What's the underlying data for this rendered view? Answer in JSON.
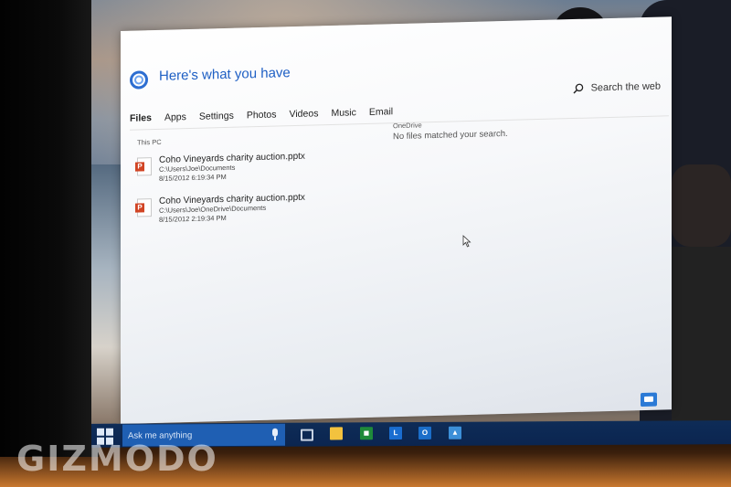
{
  "panel": {
    "title": "Here's what you have",
    "search_web_label": "Search the web",
    "tabs": [
      "Files",
      "Apps",
      "Settings",
      "Photos",
      "Videos",
      "Music",
      "Email"
    ],
    "active_tab": "Files"
  },
  "this_pc": {
    "label": "This PC",
    "files": [
      {
        "name": "Coho Vineyards charity auction.pptx",
        "path": "C:\\Users\\Joe\\Documents",
        "date": "8/15/2012 6:19:34 PM"
      },
      {
        "name": "Coho Vineyards charity auction.pptx",
        "path": "C:\\Users\\Joe\\OneDrive\\Documents",
        "date": "8/15/2012 2:19:34 PM"
      }
    ]
  },
  "onedrive": {
    "label": "OneDrive",
    "message": "No files matched your search."
  },
  "taskbar": {
    "search_placeholder": "Ask me anything",
    "apps": [
      "task-view",
      "file-explorer",
      "store",
      "lync",
      "outlook",
      "photos"
    ]
  },
  "watermark": "GIZMODO",
  "colors": {
    "accent": "#1e5fc4",
    "taskbar": "#0b2550",
    "search_box": "#1f5fb3"
  }
}
